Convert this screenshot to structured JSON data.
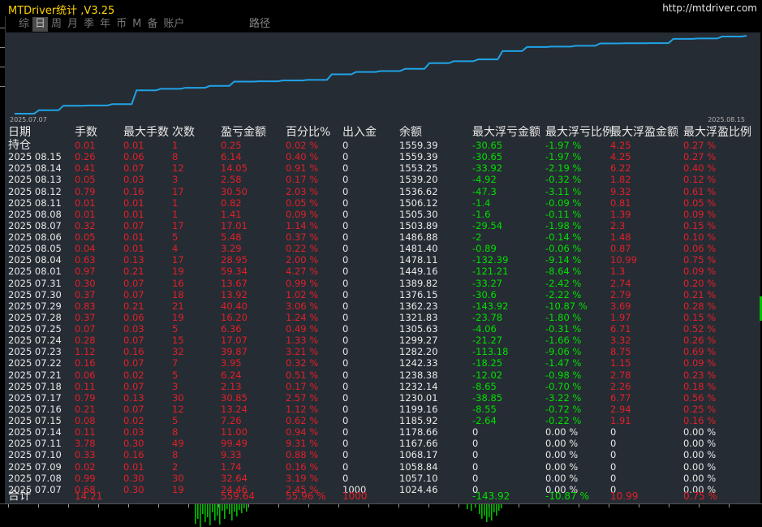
{
  "app": {
    "title": "MTDriver统计 ,V3.25",
    "url": "http://mtdriver.com"
  },
  "tabs": [
    {
      "label": "综",
      "active": false
    },
    {
      "label": "日",
      "active": true
    },
    {
      "label": "周",
      "active": false
    },
    {
      "label": "月",
      "active": false
    },
    {
      "label": "季",
      "active": false
    },
    {
      "label": "年",
      "active": false
    },
    {
      "label": "币",
      "active": false
    },
    {
      "label": "M",
      "active": false
    },
    {
      "label": "备",
      "active": false
    },
    {
      "label": "账户",
      "active": false
    }
  ],
  "path_label": "路径",
  "chart": {
    "start_date": "2025.07.07",
    "end_date": "2025.08.15",
    "line_color": "#1fa3e6"
  },
  "columns": [
    "日期",
    "手数",
    "最大手数",
    "次数",
    "盈亏金额",
    "百分比%",
    "出入金",
    "余额",
    "最大浮亏金额",
    "最大浮亏比例",
    "最大浮盈金额",
    "最大浮盈比例"
  ],
  "holding": {
    "label": "持仓",
    "lots": "0.01",
    "max_lots": "0.01",
    "count": "1",
    "pl": "0.25",
    "pct": "0.02 %",
    "deposit": "0",
    "balance": "1559.39",
    "float_loss": "-30.65",
    "float_loss_pct": "-1.97 %",
    "float_profit": "4.25",
    "float_profit_pct": "0.27 %"
  },
  "rows": [
    {
      "date": "2025 08.15",
      "lots": "0.26",
      "max_lots": "0.06",
      "count": "8",
      "pl": "6.14",
      "pct": "0.40 %",
      "deposit": "0",
      "balance": "1559.39",
      "float_loss": "-30.65",
      "float_loss_pct": "-1.97 %",
      "float_profit": "4.25",
      "float_profit_pct": "0.27 %"
    },
    {
      "date": "2025 08.14",
      "lots": "0.41",
      "max_lots": "0.07",
      "count": "12",
      "pl": "14.05",
      "pct": "0.91 %",
      "deposit": "0",
      "balance": "1553.25",
      "float_loss": "-33.92",
      "float_loss_pct": "-2.19 %",
      "float_profit": "6.22",
      "float_profit_pct": "0.40 %"
    },
    {
      "date": "2025 08.13",
      "lots": "0.05",
      "max_lots": "0.03",
      "count": "3",
      "pl": "2.58",
      "pct": "0.17 %",
      "deposit": "0",
      "balance": "1539.20",
      "float_loss": "-4.92",
      "float_loss_pct": "-0.32 %",
      "float_profit": "1.82",
      "float_profit_pct": "0.12 %"
    },
    {
      "date": "2025 08.12",
      "lots": "0.79",
      "max_lots": "0.16",
      "count": "17",
      "pl": "30.50",
      "pct": "2.03 %",
      "deposit": "0",
      "balance": "1536.62",
      "float_loss": "-47.3",
      "float_loss_pct": "-3.11 %",
      "float_profit": "9.32",
      "float_profit_pct": "0.61 %"
    },
    {
      "date": "2025 08.11",
      "lots": "0.01",
      "max_lots": "0.01",
      "count": "1",
      "pl": "0.82",
      "pct": "0.05 %",
      "deposit": "0",
      "balance": "1506.12",
      "float_loss": "-1.4",
      "float_loss_pct": "-0.09 %",
      "float_profit": "0.81",
      "float_profit_pct": "0.05 %"
    },
    {
      "date": "2025 08.08",
      "lots": "0.01",
      "max_lots": "0.01",
      "count": "1",
      "pl": "1.41",
      "pct": "0.09 %",
      "deposit": "0",
      "balance": "1505.30",
      "float_loss": "-1.6",
      "float_loss_pct": "-0.11 %",
      "float_profit": "1.39",
      "float_profit_pct": "0.09 %"
    },
    {
      "date": "2025 08.07",
      "lots": "0.32",
      "max_lots": "0.07",
      "count": "17",
      "pl": "17.01",
      "pct": "1.14 %",
      "deposit": "0",
      "balance": "1503.89",
      "float_loss": "-29.54",
      "float_loss_pct": "-1.98 %",
      "float_profit": "2.3",
      "float_profit_pct": "0.15 %"
    },
    {
      "date": "2025 08.06",
      "lots": "0.05",
      "max_lots": "0.01",
      "count": "5",
      "pl": "5.48",
      "pct": "0.37 %",
      "deposit": "0",
      "balance": "1486.88",
      "float_loss": "-2",
      "float_loss_pct": "-0.14 %",
      "float_profit": "1.48",
      "float_profit_pct": "0.10 %"
    },
    {
      "date": "2025 08.05",
      "lots": "0.04",
      "max_lots": "0.01",
      "count": "4",
      "pl": "3.29",
      "pct": "0.22 %",
      "deposit": "0",
      "balance": "1481.40",
      "float_loss": "-0.89",
      "float_loss_pct": "-0.06 %",
      "float_profit": "0.87",
      "float_profit_pct": "0.06 %"
    },
    {
      "date": "2025 08.04",
      "lots": "0.63",
      "max_lots": "0.13",
      "count": "17",
      "pl": "28.95",
      "pct": "2.00 %",
      "deposit": "0",
      "balance": "1478.11",
      "float_loss": "-132.39",
      "float_loss_pct": "-9.14 %",
      "float_profit": "10.99",
      "float_profit_pct": "0.75 %"
    },
    {
      "date": "2025 08.01",
      "lots": "0.97",
      "max_lots": "0.21",
      "count": "19",
      "pl": "59.34",
      "pct": "4.27 %",
      "deposit": "0",
      "balance": "1449.16",
      "float_loss": "-121.21",
      "float_loss_pct": "-8.64 %",
      "float_profit": "1.3",
      "float_profit_pct": "0.09 %"
    },
    {
      "date": "2025 07.31",
      "lots": "0.30",
      "max_lots": "0.07",
      "count": "16",
      "pl": "13.67",
      "pct": "0.99 %",
      "deposit": "0",
      "balance": "1389.82",
      "float_loss": "-33.27",
      "float_loss_pct": "-2.42 %",
      "float_profit": "2.74",
      "float_profit_pct": "0.20 %"
    },
    {
      "date": "2025 07.30",
      "lots": "0.37",
      "max_lots": "0.07",
      "count": "18",
      "pl": "13.92",
      "pct": "1.02 %",
      "deposit": "0",
      "balance": "1376.15",
      "float_loss": "-30.6",
      "float_loss_pct": "-2.22 %",
      "float_profit": "2.79",
      "float_profit_pct": "0.21 %"
    },
    {
      "date": "2025 07.29",
      "lots": "0.83",
      "max_lots": "0.21",
      "count": "21",
      "pl": "40.40",
      "pct": "3.06 %",
      "deposit": "0",
      "balance": "1362.23",
      "float_loss": "-143.92",
      "float_loss_pct": "-10.87 %",
      "float_profit": "3.69",
      "float_profit_pct": "0.28 %"
    },
    {
      "date": "2025 07.28",
      "lots": "0.37",
      "max_lots": "0.06",
      "count": "19",
      "pl": "16.20",
      "pct": "1.24 %",
      "deposit": "0",
      "balance": "1321.83",
      "float_loss": "-23.78",
      "float_loss_pct": "-1.80 %",
      "float_profit": "1.97",
      "float_profit_pct": "0.15 %"
    },
    {
      "date": "2025 07.25",
      "lots": "0.07",
      "max_lots": "0.03",
      "count": "5",
      "pl": "6.36",
      "pct": "0.49 %",
      "deposit": "0",
      "balance": "1305.63",
      "float_loss": "-4.06",
      "float_loss_pct": "-0.31 %",
      "float_profit": "6.71",
      "float_profit_pct": "0.52 %"
    },
    {
      "date": "2025 07.24",
      "lots": "0.28",
      "max_lots": "0.07",
      "count": "15",
      "pl": "17.07",
      "pct": "1.33 %",
      "deposit": "0",
      "balance": "1299.27",
      "float_loss": "-21.27",
      "float_loss_pct": "-1.66 %",
      "float_profit": "3.32",
      "float_profit_pct": "0.26 %"
    },
    {
      "date": "2025 07.23",
      "lots": "1.12",
      "max_lots": "0.16",
      "count": "32",
      "pl": "39.87",
      "pct": "3.21 %",
      "deposit": "0",
      "balance": "1282.20",
      "float_loss": "-113.18",
      "float_loss_pct": "-9.06 %",
      "float_profit": "8.75",
      "float_profit_pct": "0.69 %"
    },
    {
      "date": "2025 07.22",
      "lots": "0.16",
      "max_lots": "0.07",
      "count": "7",
      "pl": "3.95",
      "pct": "0.32 %",
      "deposit": "0",
      "balance": "1242.33",
      "float_loss": "-18.25",
      "float_loss_pct": "-1.47 %",
      "float_profit": "1.15",
      "float_profit_pct": "0.09 %"
    },
    {
      "date": "2025 07.21",
      "lots": "0.06",
      "max_lots": "0.02",
      "count": "5",
      "pl": "6.24",
      "pct": "0.51 %",
      "deposit": "0",
      "balance": "1238.38",
      "float_loss": "-12.02",
      "float_loss_pct": "-0.98 %",
      "float_profit": "2.78",
      "float_profit_pct": "0.23 %"
    },
    {
      "date": "2025 07.18",
      "lots": "0.11",
      "max_lots": "0.07",
      "count": "3",
      "pl": "2.13",
      "pct": "0.17 %",
      "deposit": "0",
      "balance": "1232.14",
      "float_loss": "-8.65",
      "float_loss_pct": "-0.70 %",
      "float_profit": "2.26",
      "float_profit_pct": "0.18 %"
    },
    {
      "date": "2025 07.17",
      "lots": "0.79",
      "max_lots": "0.13",
      "count": "30",
      "pl": "30.85",
      "pct": "2.57 %",
      "deposit": "0",
      "balance": "1230.01",
      "float_loss": "-38.85",
      "float_loss_pct": "-3.22 %",
      "float_profit": "6.77",
      "float_profit_pct": "0.56 %"
    },
    {
      "date": "2025 07.16",
      "lots": "0.21",
      "max_lots": "0.07",
      "count": "12",
      "pl": "13.24",
      "pct": "1.12 %",
      "deposit": "0",
      "balance": "1199.16",
      "float_loss": "-8.55",
      "float_loss_pct": "-0.72 %",
      "float_profit": "2.94",
      "float_profit_pct": "0.25 %"
    },
    {
      "date": "2025 07.15",
      "lots": "0.08",
      "max_lots": "0.02",
      "count": "5",
      "pl": "7.26",
      "pct": "0.62 %",
      "deposit": "0",
      "balance": "1185.92",
      "float_loss": "-2.64",
      "float_loss_pct": "-0.22 %",
      "float_profit": "1.91",
      "float_profit_pct": "0.16 %"
    },
    {
      "date": "2025 07.14",
      "lots": "0.11",
      "max_lots": "0.03",
      "count": "8",
      "pl": "11.00",
      "pct": "0.94 %",
      "deposit": "0",
      "balance": "1178.66",
      "float_loss": "0",
      "float_loss_pct": "0.00 %",
      "float_profit": "0",
      "float_profit_pct": "0.00 %"
    },
    {
      "date": "2025 07.11",
      "lots": "3.78",
      "max_lots": "0.30",
      "count": "49",
      "pl": "99.49",
      "pct": "9.31 %",
      "deposit": "0",
      "balance": "1167.66",
      "float_loss": "0",
      "float_loss_pct": "0.00 %",
      "float_profit": "0",
      "float_profit_pct": "0.00 %"
    },
    {
      "date": "2025 07.10",
      "lots": "0.33",
      "max_lots": "0.16",
      "count": "8",
      "pl": "9.33",
      "pct": "0.88 %",
      "deposit": "0",
      "balance": "1068.17",
      "float_loss": "0",
      "float_loss_pct": "0.00 %",
      "float_profit": "0",
      "float_profit_pct": "0.00 %"
    },
    {
      "date": "2025 07.09",
      "lots": "0.02",
      "max_lots": "0.01",
      "count": "2",
      "pl": "1.74",
      "pct": "0.16 %",
      "deposit": "0",
      "balance": "1058.84",
      "float_loss": "0",
      "float_loss_pct": "0.00 %",
      "float_profit": "0",
      "float_profit_pct": "0.00 %"
    },
    {
      "date": "2025 07.08",
      "lots": "0.99",
      "max_lots": "0.30",
      "count": "30",
      "pl": "32.64",
      "pct": "3.19 %",
      "deposit": "0",
      "balance": "1057.10",
      "float_loss": "0",
      "float_loss_pct": "0.00 %",
      "float_profit": "0",
      "float_profit_pct": "0.00 %"
    },
    {
      "date": "2025 07.07",
      "lots": "0.68",
      "max_lots": "0.30",
      "count": "19",
      "pl": "24.46",
      "pct": "2.45 %",
      "deposit": "1000",
      "balance": "1024.46",
      "float_loss": "0",
      "float_loss_pct": "0.00 %",
      "float_profit": "0",
      "float_profit_pct": "0.00 %"
    }
  ],
  "total": {
    "label": "合计",
    "lots": "14.21",
    "pl": "559.64",
    "pct": "55.96 %",
    "deposit": "1000",
    "float_loss": "-143.92",
    "float_loss_pct": "-10.87 %",
    "float_profit": "10.99",
    "float_profit_pct": "0.75 %"
  },
  "colors": {
    "loss": "#e0202a",
    "gain": "#00e000",
    "text": "#e8e8e8",
    "title": "#ffd400",
    "panel": "#262c33"
  }
}
